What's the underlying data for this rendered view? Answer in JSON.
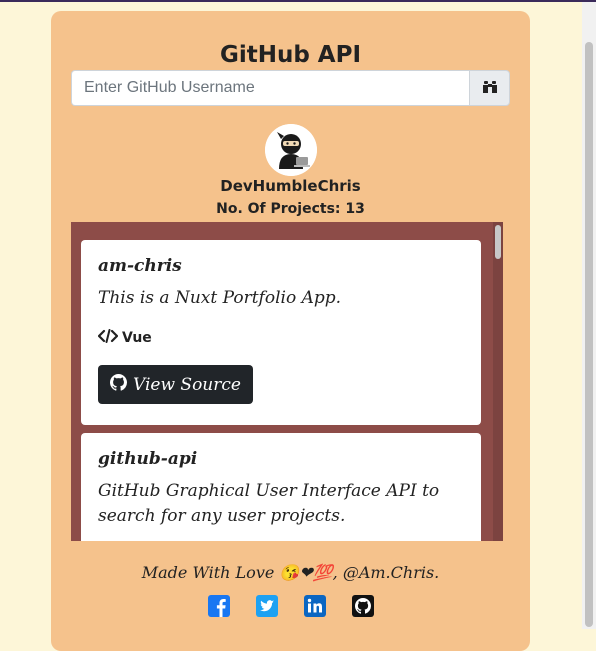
{
  "header": {
    "title": "GitHub API"
  },
  "search": {
    "placeholder": "Enter GitHub Username",
    "value": "",
    "button_icon": "binoculars-icon"
  },
  "profile": {
    "username": "DevHumbleChris",
    "project_count": "No. Of Projects: 13"
  },
  "repos": [
    {
      "name": "am-chris",
      "description": "This is a Nuxt Portfolio App.",
      "language": "Vue",
      "button_label": "View Source"
    },
    {
      "name": "github-api",
      "description": "GitHub Graphical User Interface API to search for any user projects."
    }
  ],
  "footer": {
    "text": "Made With Love 😘❤💯, @Am.Chris.",
    "social": [
      {
        "icon": "facebook-icon",
        "color": "#1877f2"
      },
      {
        "icon": "twitter-icon",
        "color": "#1da1f2"
      },
      {
        "icon": "linkedin-icon",
        "color": "#0a66c2"
      },
      {
        "icon": "github-icon",
        "color": "#111111"
      }
    ]
  },
  "colors": {
    "page_background": "#fdf6d8",
    "card_background": "#f5c28c",
    "repo_panel": "#8d4c48",
    "button_dark": "#212529"
  }
}
